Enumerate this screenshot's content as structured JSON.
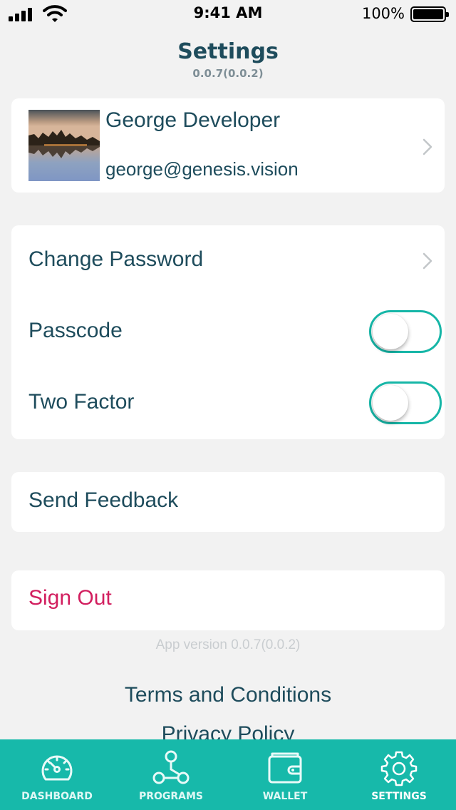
{
  "status_bar": {
    "time": "9:41 AM",
    "battery_percent": "100%"
  },
  "header": {
    "title": "Settings",
    "subtitle": "0.0.7(0.0.2)"
  },
  "profile": {
    "name": "George Developer",
    "email": "george@genesis.vision"
  },
  "security": {
    "change_password_label": "Change Password",
    "passcode_label": "Passcode",
    "passcode_enabled": false,
    "two_factor_label": "Two Factor",
    "two_factor_enabled": false
  },
  "feedback": {
    "label": "Send Feedback"
  },
  "sign_out": {
    "label": "Sign Out"
  },
  "footer": {
    "app_version": "App version 0.0.7(0.0.2)",
    "terms_label": "Terms and Conditions",
    "privacy_label": "Privacy Policy"
  },
  "tabs": [
    {
      "label": "DASHBOARD",
      "icon": "dashboard-icon",
      "active": false
    },
    {
      "label": "PROGRAMS",
      "icon": "programs-icon",
      "active": false
    },
    {
      "label": "WALLET",
      "icon": "wallet-icon",
      "active": false
    },
    {
      "label": "SETTINGS",
      "icon": "gear-icon",
      "active": true
    }
  ],
  "colors": {
    "accent": "#17b9aa",
    "primary_text": "#1e4c5c",
    "danger_text": "#d21f5f",
    "background": "#f2f2f2"
  }
}
